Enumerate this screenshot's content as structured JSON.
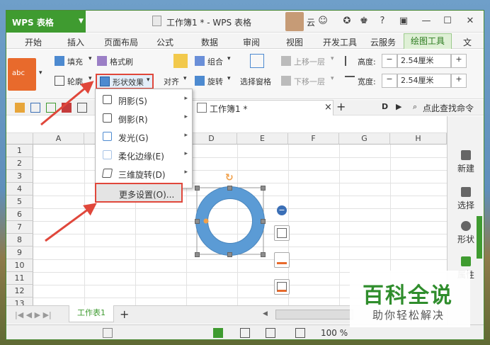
{
  "app": {
    "name": "WPS 表格",
    "document_title": "工作簿1 * - WPS 表格",
    "user": "云"
  },
  "menu_tabs": [
    "开始",
    "插入",
    "页面布局",
    "公式",
    "数据",
    "审阅",
    "视图",
    "开发工具",
    "云服务",
    "绘图工具",
    "文"
  ],
  "active_tab": "绘图工具",
  "ribbon": {
    "style_thumb": "abc",
    "fill": "填充",
    "format_painter": "格式刷",
    "outline": "轮廓",
    "shape_effect": "形状效果",
    "align": "对齐",
    "group": "组合",
    "rotate": "旋转",
    "selection_pane": "选择窗格",
    "bring_forward": "上移一层",
    "send_backward": "下移一层",
    "height_label": "高度:",
    "height_value": "2.54厘米",
    "width_label": "宽度:",
    "width_value": "2.54厘米",
    "minus": "−",
    "plus": "+"
  },
  "doc_tab": {
    "name": "工作簿1 *",
    "close": "×",
    "add": "+"
  },
  "search_cmd": "点此查找命令",
  "effect_menu": {
    "items": [
      {
        "label": "阴影(S)",
        "has_submenu": true
      },
      {
        "label": "倒影(R)",
        "has_submenu": true
      },
      {
        "label": "发光(G)",
        "has_submenu": true
      },
      {
        "label": "柔化边缘(E)",
        "has_submenu": true
      },
      {
        "label": "三维旋转(D)",
        "has_submenu": true
      }
    ],
    "more": "更多设置(O)...",
    "submenu_arrow": "▸"
  },
  "columns": [
    "A",
    "B",
    "C",
    "D",
    "E",
    "F",
    "G",
    "H"
  ],
  "rows": [
    "1",
    "2",
    "3",
    "4",
    "5",
    "6",
    "7",
    "8",
    "9",
    "10",
    "11",
    "12",
    "13"
  ],
  "right_panel": [
    {
      "label": "新建"
    },
    {
      "label": "选择"
    },
    {
      "label": "形状"
    },
    {
      "label": "属性"
    }
  ],
  "sheet": {
    "tab": "工作表1",
    "add": "+"
  },
  "status": {
    "zoom": "100 %"
  },
  "watermark": {
    "title": "百科全说",
    "subtitle": "助你轻松解决"
  },
  "colors": {
    "accent": "#3f9b30",
    "highlight": "#e0473b",
    "ring": "#5b9bd5"
  }
}
